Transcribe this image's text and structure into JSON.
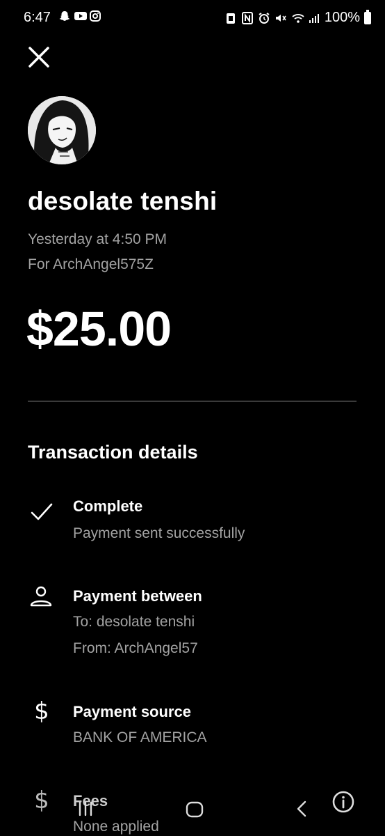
{
  "status_bar": {
    "time": "6:47",
    "battery": "100%",
    "left_icons": [
      "snapchat-icon",
      "youtube-icon",
      "instagram-icon"
    ],
    "right_icons": [
      "clipboard-icon",
      "nfc-icon",
      "alarm-icon",
      "mute-icon",
      "wifi-icon",
      "signal-icon",
      "battery-icon"
    ]
  },
  "header": {
    "recipient_name": "desolate tenshi",
    "datetime": "Yesterday at 4:50 PM",
    "memo": "For ArchAngel575Z",
    "amount": "$25.00"
  },
  "transaction": {
    "section_title": "Transaction details",
    "status": {
      "title": "Complete",
      "subtitle": "Payment sent successfully"
    },
    "between": {
      "title": "Payment between",
      "to": "To: desolate tenshi",
      "from": "From: ArchAngel57"
    },
    "source": {
      "title": "Payment source",
      "bank": "BANK OF AMERICA"
    },
    "fees": {
      "title": "Fees",
      "value": "None applied"
    }
  },
  "colors": {
    "background": "#000000",
    "primary_text": "#ffffff",
    "secondary_text": "#a2a2a2",
    "divider": "#3a3a3a"
  }
}
